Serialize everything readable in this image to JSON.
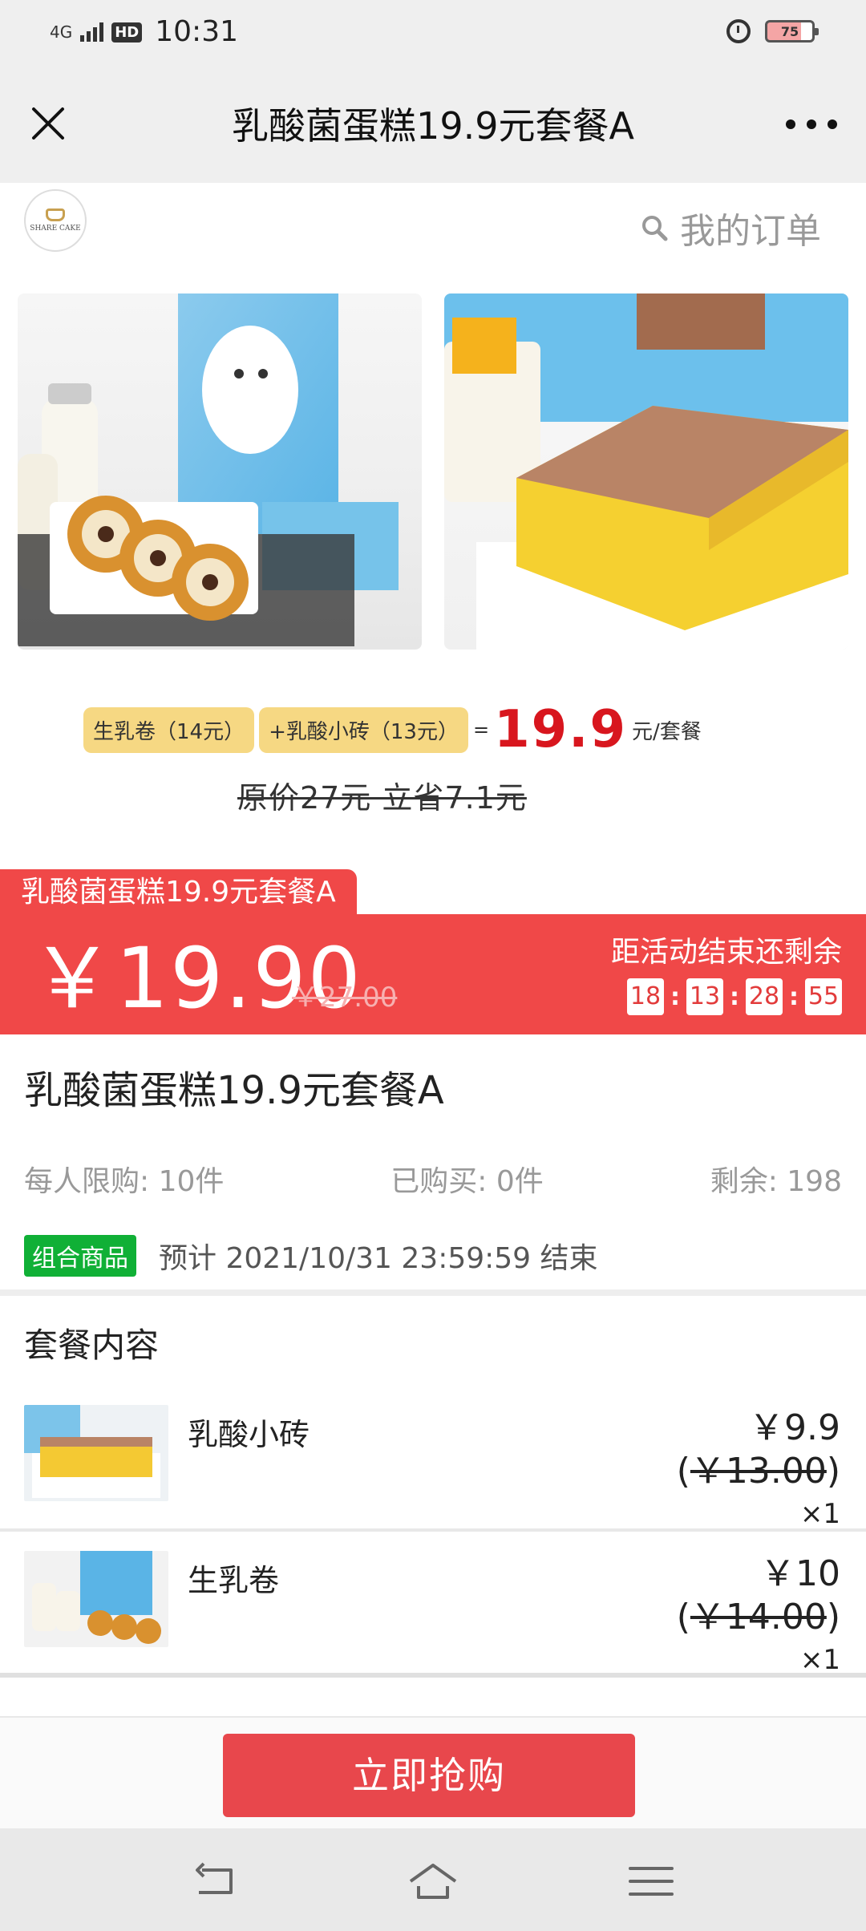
{
  "status_bar": {
    "network": "4G",
    "hd": "HD",
    "time": "10:31",
    "battery": "75"
  },
  "title_bar": {
    "title": "乳酸菌蛋糕19.9元套餐A"
  },
  "shop": {
    "logo_text": "SHARE CAKE",
    "my_orders": "我的订单"
  },
  "promo": {
    "tag_1": "生乳卷（14元）",
    "tag_2": "+乳酸小砖（13元）",
    "equals": "=",
    "price": "19.9",
    "unit": "元/套餐",
    "original": "原价27元  立省7.1元"
  },
  "activity": {
    "label": "乳酸菌蛋糕19.9元套餐A",
    "price": "￥19.90",
    "original_price": "￥27.00",
    "countdown_label": "距活动结束还剩余",
    "countdown": [
      "18",
      "13",
      "28",
      "55"
    ]
  },
  "product": {
    "name": "乳酸菌蛋糕19.9元套餐A",
    "limit": "每人限购: 10件",
    "bought": "已购买: 0件",
    "remaining": "剩余: 198",
    "combo_badge": "组合商品",
    "end_time": "预计 2021/10/31 23:59:59 结束"
  },
  "package": {
    "title": "套餐内容",
    "items": [
      {
        "name": "乳酸小砖",
        "price": "￥9.9",
        "orig_open": "(",
        "orig": "￥13.00",
        "orig_close": ")",
        "qty": "×1"
      },
      {
        "name": "生乳卷",
        "price": "￥10",
        "orig_open": "(",
        "orig": "￥14.00",
        "orig_close": ")",
        "qty": "×1"
      }
    ]
  },
  "bottom": {
    "buy_label": "立即抢购"
  },
  "colors": {
    "accent_red": "#f04848",
    "price_red": "#d8161e",
    "combo_green": "#10b036",
    "tag_yellow": "#f6d883"
  },
  "icons": [
    "close-icon",
    "more-icon",
    "search-icon",
    "back-icon",
    "home-icon",
    "menu-icon",
    "alarm-icon",
    "battery-icon"
  ]
}
